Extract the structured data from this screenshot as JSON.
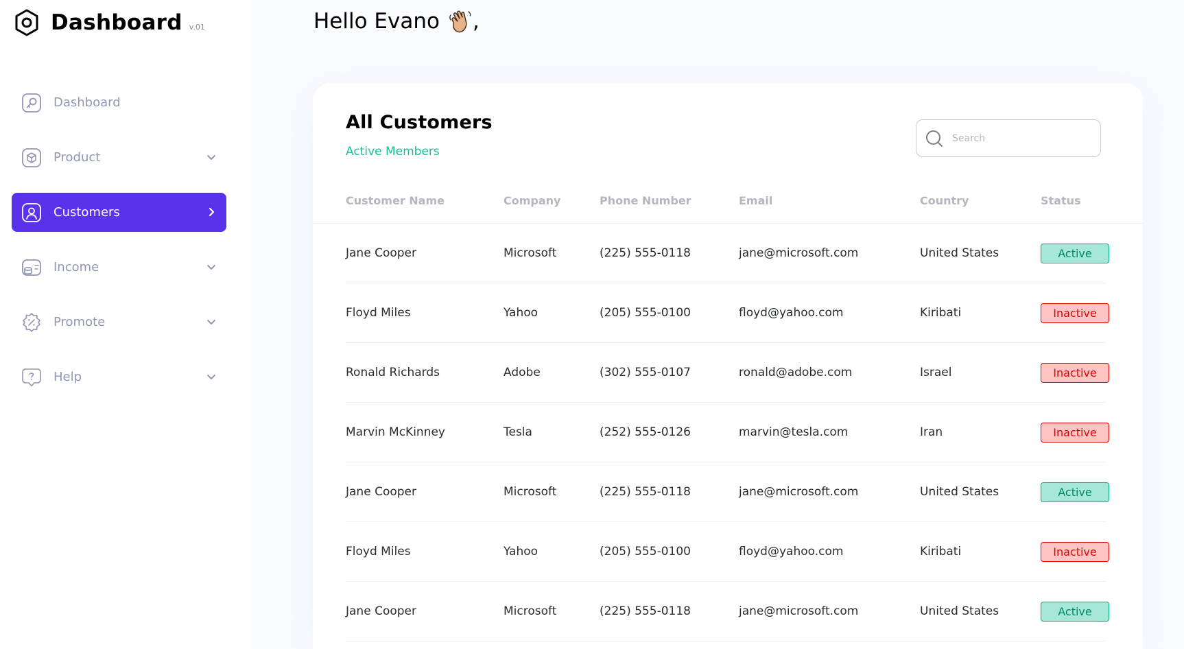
{
  "sidebar": {
    "brand_title": "Dashboard",
    "brand_version": "v.01",
    "items": [
      {
        "label": "Dashboard",
        "icon": "key-square-icon",
        "has_chevron": false
      },
      {
        "label": "Product",
        "icon": "cube-icon",
        "has_chevron": true
      },
      {
        "label": "Customers",
        "icon": "user-square-icon",
        "has_chevron": true
      },
      {
        "label": "Income",
        "icon": "wallet-money-icon",
        "has_chevron": true
      },
      {
        "label": "Promote",
        "icon": "discount-shape-icon",
        "has_chevron": true
      },
      {
        "label": "Help",
        "icon": "message-question-icon",
        "has_chevron": true
      }
    ],
    "active_item": "Customers"
  },
  "header": {
    "greeting": "Hello Evano",
    "wave_icon": "waving-hand-icon",
    "comma": ","
  },
  "card": {
    "title": "All Customers",
    "subtitle": "Active Members",
    "search_placeholder": "Search",
    "columns": [
      "Customer Name",
      "Company",
      "Phone Number",
      "Email",
      "Country",
      "Status"
    ],
    "rows": [
      {
        "name": "Jane Cooper",
        "company": "Microsoft",
        "phone": "(225) 555-0118",
        "email": "jane@microsoft.com",
        "country": "United States",
        "status": "Active"
      },
      {
        "name": "Floyd Miles",
        "company": "Yahoo",
        "phone": "(205) 555-0100",
        "email": "floyd@yahoo.com",
        "country": "Kiribati",
        "status": "Inactive"
      },
      {
        "name": "Ronald Richards",
        "company": "Adobe",
        "phone": "(302) 555-0107",
        "email": "ronald@adobe.com",
        "country": "Israel",
        "status": "Inactive"
      },
      {
        "name": "Marvin McKinney",
        "company": "Tesla",
        "phone": "(252) 555-0126",
        "email": "marvin@tesla.com",
        "country": "Iran",
        "status": "Inactive"
      },
      {
        "name": "Jane Cooper",
        "company": "Microsoft",
        "phone": "(225) 555-0118",
        "email": "jane@microsoft.com",
        "country": "United States",
        "status": "Active"
      },
      {
        "name": "Floyd Miles",
        "company": "Yahoo",
        "phone": "(205) 555-0100",
        "email": "floyd@yahoo.com",
        "country": "Kiribati",
        "status": "Inactive"
      },
      {
        "name": "Jane Cooper",
        "company": "Microsoft",
        "phone": "(225) 555-0118",
        "email": "jane@microsoft.com",
        "country": "United States",
        "status": "Active"
      }
    ]
  },
  "colors": {
    "accent": "#5932ea",
    "active_text": "#008767",
    "active_bg": "#a6e7d8",
    "inactive_text": "#df0404",
    "inactive_bg": "#ffc5c5",
    "subtitle": "#16c098",
    "muted": "#9197b3"
  }
}
